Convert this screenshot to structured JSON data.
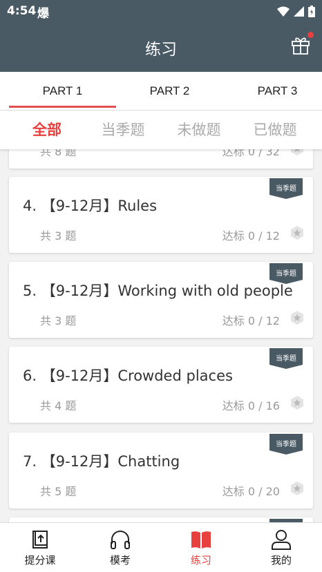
{
  "status_bar": {
    "time": "4:54",
    "extra_glyph": "爆"
  },
  "header": {
    "title": "练习",
    "gift_icon": "gift-icon"
  },
  "part_tabs": [
    {
      "label": "PART 1",
      "active": true
    },
    {
      "label": "PART 2",
      "active": false
    },
    {
      "label": "PART 3",
      "active": false
    }
  ],
  "filter_tabs": [
    {
      "label": "全部",
      "active": true
    },
    {
      "label": "当季题",
      "active": false
    },
    {
      "label": "未做题",
      "active": false
    },
    {
      "label": "已做题",
      "active": false
    }
  ],
  "partial_card": {
    "count": "共 8 题",
    "progress": "达标 0 / 32"
  },
  "cards": [
    {
      "title": "4. 【9-12月】Rules",
      "count": "共 3 题",
      "progress": "达标 0 / 12",
      "badge": "当季题"
    },
    {
      "title": "5. 【9-12月】Working with old people",
      "count": "共 3 题",
      "progress": "达标 0 / 12",
      "badge": "当季题"
    },
    {
      "title": "6. 【9-12月】Crowded places",
      "count": "共 4 题",
      "progress": "达标 0 / 16",
      "badge": "当季题"
    },
    {
      "title": "7. 【9-12月】Chatting",
      "count": "共 5 题",
      "progress": "达标 0 / 20",
      "badge": "当季题"
    }
  ],
  "bottom_nav": [
    {
      "label": "提分课",
      "icon": "upload-book-icon",
      "active": false
    },
    {
      "label": "模考",
      "icon": "headphones-icon",
      "active": false
    },
    {
      "label": "练习",
      "icon": "book-icon",
      "active": true
    },
    {
      "label": "我的",
      "icon": "person-icon",
      "active": false
    }
  ],
  "colors": {
    "header": "#4a5a64",
    "accent": "#e8403e",
    "badge": "#4a5a64"
  }
}
